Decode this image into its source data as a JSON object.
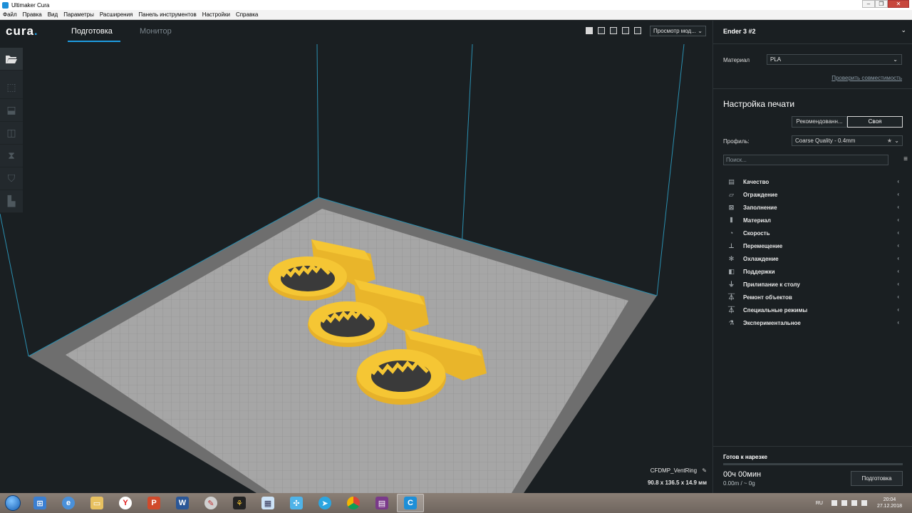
{
  "window": {
    "title": "Ultimaker Cura"
  },
  "menu": [
    "Файл",
    "Правка",
    "Вид",
    "Параметры",
    "Расширения",
    "Панель инструментов",
    "Настройки",
    "Справка"
  ],
  "header": {
    "logo": "cura",
    "tabs": {
      "prepare": "Подготовка",
      "monitor": "Монитор"
    },
    "view_mode": "Просмотр мод..."
  },
  "toolbar": {
    "icons": [
      "folder-open-icon",
      "move-icon",
      "scale-icon",
      "rotate-icon",
      "mirror-icon",
      "per-model-settings-icon",
      "support-blocker-icon"
    ]
  },
  "object": {
    "name": "CFDMP_VentRing",
    "dimensions": "90.8 x 136.5 x 14.9 мм"
  },
  "sidebar": {
    "printer": "Ender 3 #2",
    "material_label": "Материал",
    "material_value": "PLA",
    "compat_link": "Проверить совместимость",
    "print_setup_title": "Настройка печати",
    "mode_recommended": "Рекомендованн...",
    "mode_custom": "Своя",
    "profile_label": "Профиль:",
    "profile_value": "Coarse Quality - 0.4mm",
    "search_placeholder": "Поиск...",
    "categories": [
      {
        "label": "Качество",
        "icon": "quality-icon"
      },
      {
        "label": "Ограждение",
        "icon": "shell-icon"
      },
      {
        "label": "Заполнение",
        "icon": "infill-icon"
      },
      {
        "label": "Материал",
        "icon": "material-icon"
      },
      {
        "label": "Скорость",
        "icon": "speed-icon"
      },
      {
        "label": "Перемещение",
        "icon": "travel-icon"
      },
      {
        "label": "Охлаждение",
        "icon": "cooling-icon"
      },
      {
        "label": "Поддержки",
        "icon": "support-icon"
      },
      {
        "label": "Прилипание к столу",
        "icon": "adhesion-icon"
      },
      {
        "label": "Ремонт объектов",
        "icon": "mesh-fix-icon"
      },
      {
        "label": "Специальные режимы",
        "icon": "special-modes-icon"
      },
      {
        "label": "Экспериментальное",
        "icon": "experimental-icon"
      }
    ],
    "ready_label": "Готов к нарезке",
    "time": "00ч 00мин",
    "usage": "0.00m / ~ 0g",
    "slice_button": "Подготовка"
  },
  "taskbar": {
    "lang": "RU",
    "time": "20:04",
    "date": "27.12.2018"
  },
  "colors": {
    "accent": "#1e9be0",
    "model": "#f5c634",
    "plate": "#9e9e9e"
  }
}
